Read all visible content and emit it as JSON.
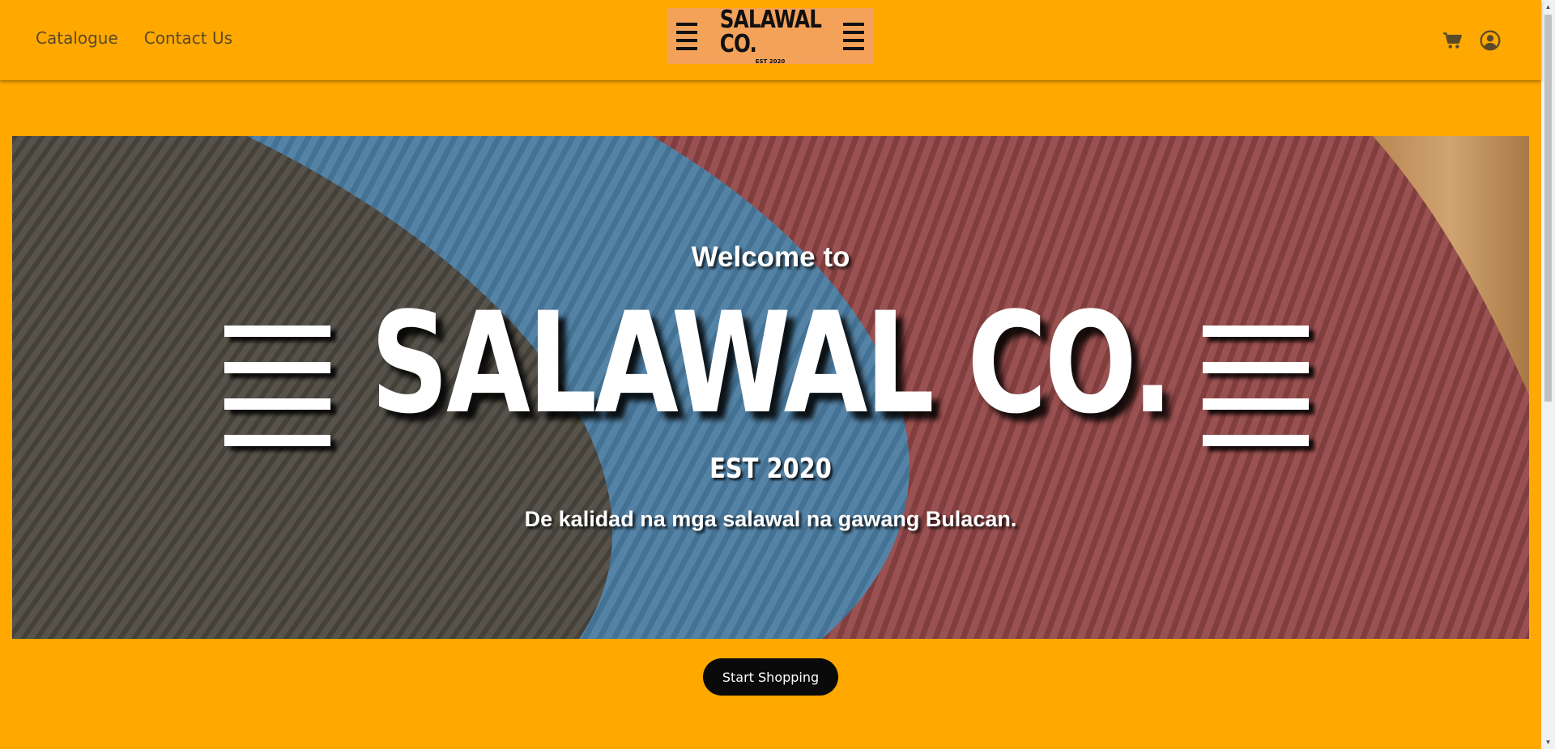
{
  "nav": {
    "catalogue_label": "Catalogue",
    "contact_label": "Contact Us"
  },
  "logo": {
    "title": "SALAWAL CO.",
    "est": "EST 2020"
  },
  "icons": {
    "cart": "shopping-cart-icon",
    "account": "user-circle-icon"
  },
  "hero": {
    "welcome": "Welcome to",
    "title": "SALAWAL CO.",
    "est": "EST 2020",
    "tagline": "De kalidad na mga salawal na gawang Bulacan.",
    "image": "photo of gray, blue and red drawstring pants waistbands"
  },
  "cta": {
    "label": "Start Shopping"
  },
  "colors": {
    "brand": "#FFA800",
    "logo_bg": "#F4A25A",
    "button": "#0A0A0A",
    "text_dark": "#5A4A2A"
  }
}
